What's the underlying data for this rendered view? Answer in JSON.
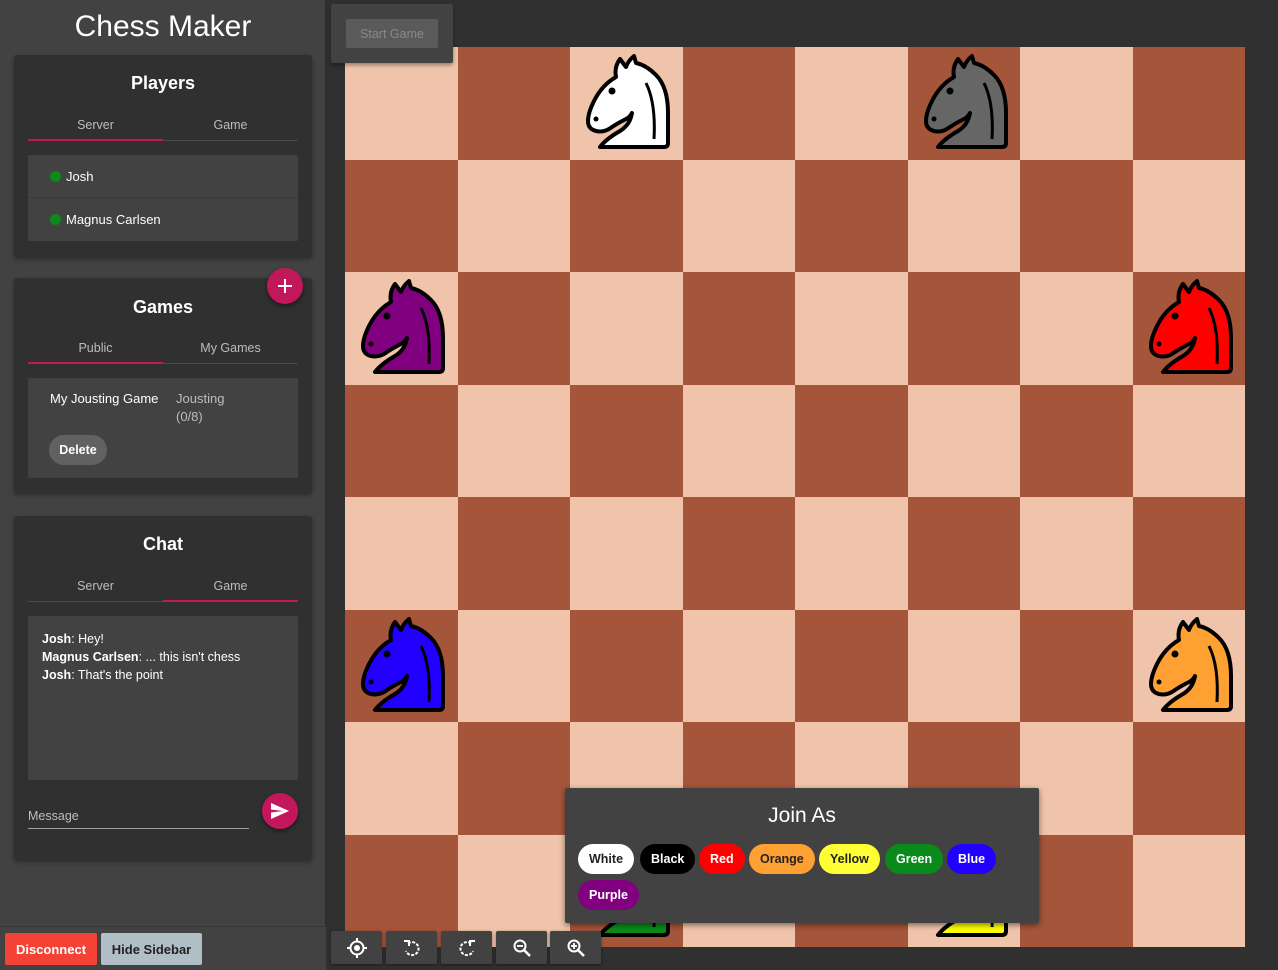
{
  "app": {
    "title": "Chess Maker"
  },
  "players": {
    "title": "Players",
    "tabs": [
      {
        "label": "Server",
        "active": true
      },
      {
        "label": "Game",
        "active": false
      }
    ],
    "list": [
      {
        "name": "Josh",
        "status": "online"
      },
      {
        "name": "Magnus Carlsen",
        "status": "online"
      }
    ]
  },
  "games": {
    "title": "Games",
    "add_icon": "plus-icon",
    "tabs": [
      {
        "label": "Public",
        "active": true
      },
      {
        "label": "My Games",
        "active": false
      }
    ],
    "items": [
      {
        "name": "My Jousting Game",
        "type": "Jousting",
        "count": "(0/8)",
        "delete_label": "Delete"
      }
    ]
  },
  "chat": {
    "title": "Chat",
    "tabs": [
      {
        "label": "Server",
        "active": false
      },
      {
        "label": "Game",
        "active": true
      }
    ],
    "messages": [
      {
        "author": "Josh",
        "text": ": Hey!"
      },
      {
        "author": "Magnus Carlsen",
        "text": ": ... this isn't chess"
      },
      {
        "author": "Josh",
        "text": ": That's the point"
      }
    ],
    "input_placeholder": "Message",
    "send_icon": "send-icon"
  },
  "footer": {
    "disconnect_label": "Disconnect",
    "hide_sidebar_label": "Hide Sidebar"
  },
  "board": {
    "start_game_label": "Start Game",
    "light_color": "#f0c4aa",
    "dark_color": "#a4553a",
    "pieces": [
      {
        "type": "knight",
        "color": "white",
        "fill": "#ffffff",
        "row": 0,
        "col": 2
      },
      {
        "type": "knight",
        "color": "black",
        "fill": "#666666",
        "row": 0,
        "col": 5
      },
      {
        "type": "knight",
        "color": "purple",
        "fill": "#800080",
        "row": 2,
        "col": 0
      },
      {
        "type": "knight",
        "color": "red",
        "fill": "#ff0000",
        "row": 2,
        "col": 7
      },
      {
        "type": "knight",
        "color": "blue",
        "fill": "#2200ff",
        "row": 5,
        "col": 0
      },
      {
        "type": "knight",
        "color": "orange",
        "fill": "#ffa032",
        "row": 5,
        "col": 7
      },
      {
        "type": "knight",
        "color": "green",
        "fill": "#0a8a1a",
        "row": 7,
        "col": 2
      },
      {
        "type": "knight",
        "color": "yellow",
        "fill": "#ffff00",
        "row": 7,
        "col": 5
      }
    ]
  },
  "join": {
    "title": "Join As",
    "options": [
      {
        "label": "White",
        "bg": "#ffffff",
        "fg": "#222222"
      },
      {
        "label": "Black",
        "bg": "#000000",
        "fg": "#ffffff"
      },
      {
        "label": "Red",
        "bg": "#ff0000",
        "fg": "#ffffff"
      },
      {
        "label": "Orange",
        "bg": "#ffa032",
        "fg": "#222222"
      },
      {
        "label": "Yellow",
        "bg": "#ffff33",
        "fg": "#222222"
      },
      {
        "label": "Green",
        "bg": "#0a8a1a",
        "fg": "#ffffff"
      },
      {
        "label": "Blue",
        "bg": "#2200ff",
        "fg": "#ffffff"
      },
      {
        "label": "Purple",
        "bg": "#800080",
        "fg": "#ffffff"
      }
    ]
  },
  "toolbar": {
    "tools": [
      {
        "name": "recenter",
        "icon": "crosshair-icon"
      },
      {
        "name": "rotate-left",
        "icon": "rotate-left-icon"
      },
      {
        "name": "rotate-right",
        "icon": "rotate-right-icon"
      },
      {
        "name": "zoom-out",
        "icon": "zoom-out-icon"
      },
      {
        "name": "zoom-in",
        "icon": "zoom-in-icon"
      }
    ]
  }
}
